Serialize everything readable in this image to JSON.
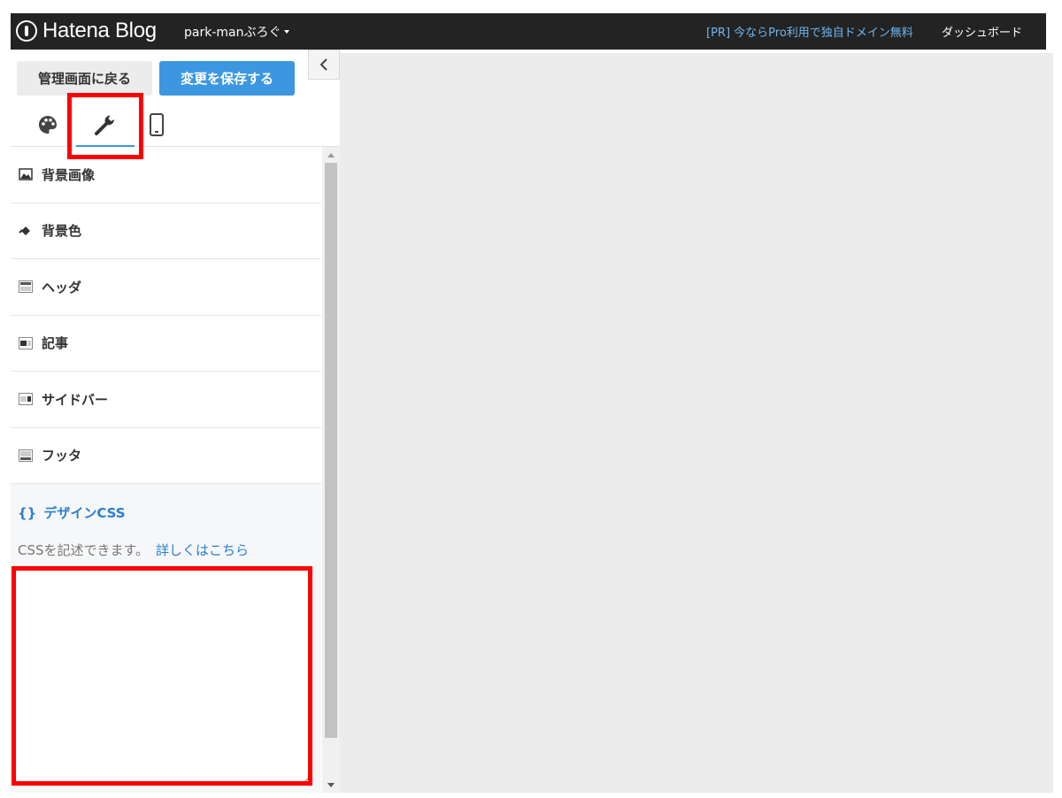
{
  "header": {
    "logo": "Hatena Blog",
    "blog_name": "park-manぶろぐ",
    "promo": "[PR] 今ならPro利用で独自ドメイン無料",
    "dashboard": "ダッシュボード"
  },
  "toolbar": {
    "back_label": "管理画面に戻る",
    "save_label": "変更を保存する"
  },
  "tabs": [
    {
      "icon": "palette-icon",
      "active": false
    },
    {
      "icon": "wrench-icon",
      "active": true
    },
    {
      "icon": "smartphone-icon",
      "active": false
    }
  ],
  "sections": [
    {
      "label": "背景画像",
      "icon": "image-icon"
    },
    {
      "label": "背景色",
      "icon": "paint-bucket-icon"
    },
    {
      "label": "ヘッダ",
      "icon": "layout-header-icon"
    },
    {
      "label": "記事",
      "icon": "layout-article-icon"
    },
    {
      "label": "サイドバー",
      "icon": "layout-sidebar-icon"
    },
    {
      "label": "フッタ",
      "icon": "layout-footer-icon"
    }
  ],
  "design_css": {
    "icon_text": "{}",
    "title": "デザインCSS",
    "description": "CSSを記述できます。",
    "link": "詳しくはこちら"
  },
  "colors": {
    "accent": "#3d97e0",
    "topbar": "#232323",
    "highlight": "#ff0000"
  }
}
